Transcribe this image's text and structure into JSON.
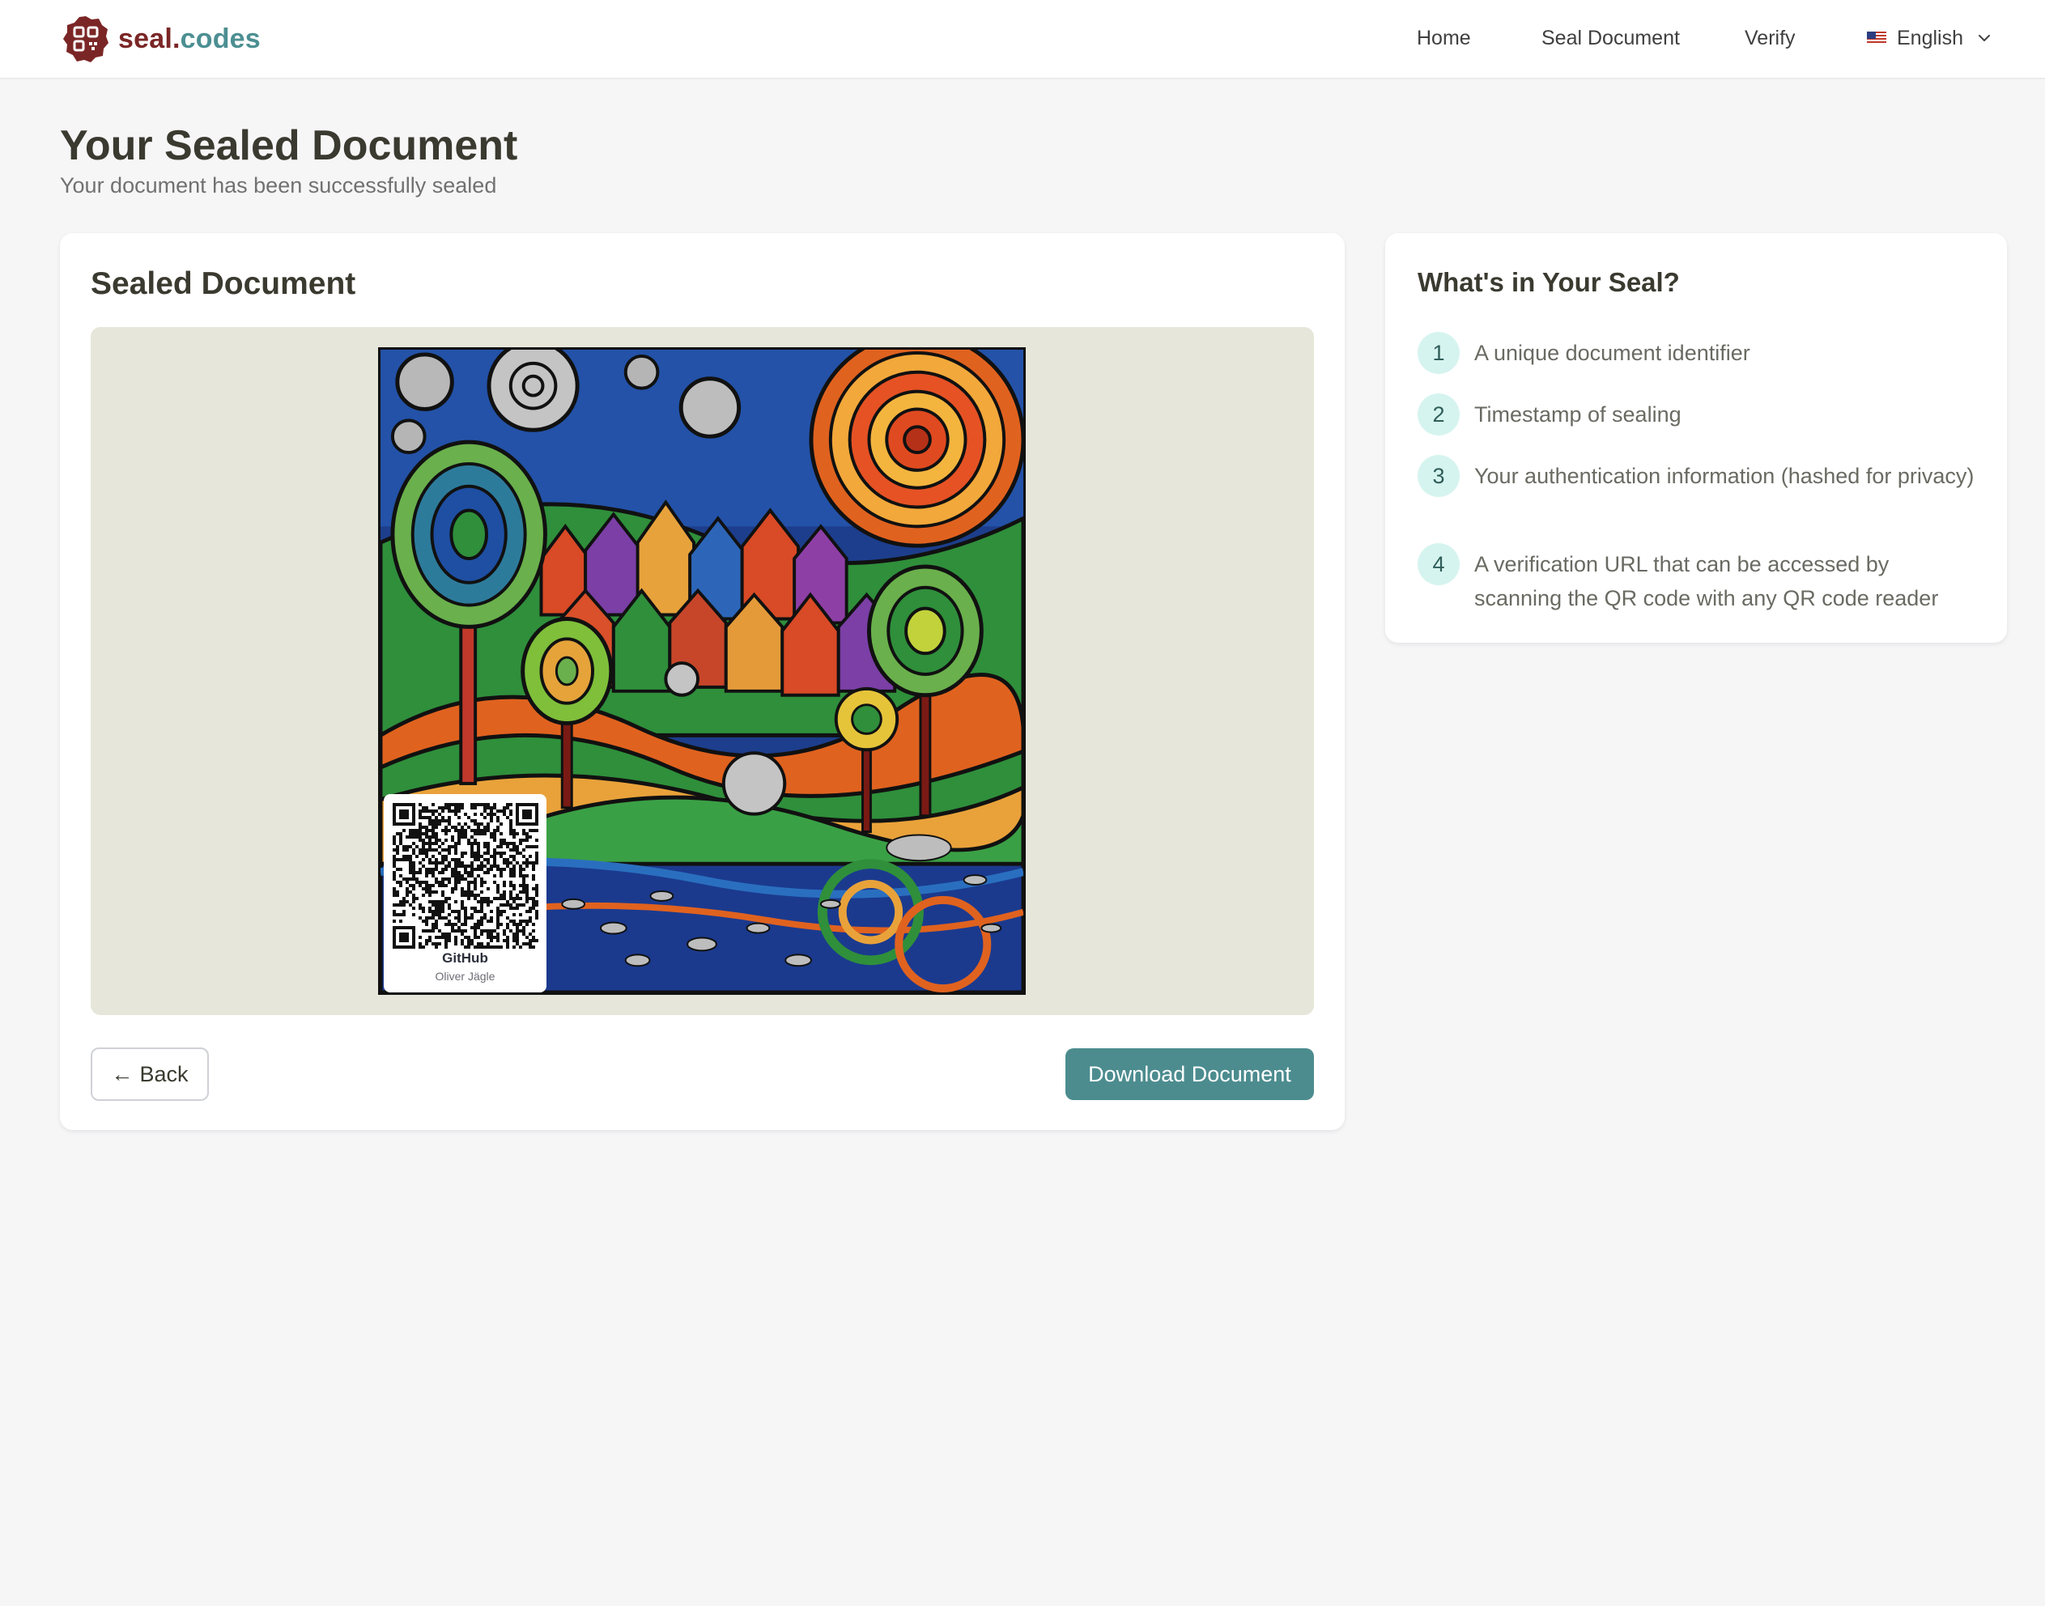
{
  "brand": {
    "name_part1": "seal",
    "name_dot": ".",
    "name_part2": "codes"
  },
  "nav": {
    "links": [
      "Home",
      "Seal Document",
      "Verify"
    ],
    "language": {
      "label": "English",
      "flag": "us-flag-icon",
      "icon": "chevron-down-icon"
    }
  },
  "header": {
    "title": "Your Sealed Document",
    "subtitle": "Your document has been successfully sealed"
  },
  "document_card": {
    "title": "Sealed Document",
    "qr_badge": {
      "title": "GitHub",
      "author": "Oliver Jägle"
    },
    "back_label": "Back",
    "back_icon": "←",
    "download_label": "Download Document"
  },
  "info_card": {
    "title": "What's in Your Seal?",
    "items": [
      {
        "number": "1",
        "text": "A unique document identifier"
      },
      {
        "number": "2",
        "text": "Timestamp of sealing"
      },
      {
        "number": "3",
        "text": "Your authentication information (hashed for privacy)"
      },
      {
        "number": "4",
        "text": "A verification URL that can be accessed by scanning the QR code with any QR code reader"
      }
    ]
  },
  "colors": {
    "brand_red": "#7b2626",
    "brand_teal": "#4c8f92",
    "primary_button": "#4c8c8f",
    "number_badge_bg": "#d6f4ef",
    "preview_bg": "#e6e7da",
    "page_bg": "#f6f6f7"
  }
}
